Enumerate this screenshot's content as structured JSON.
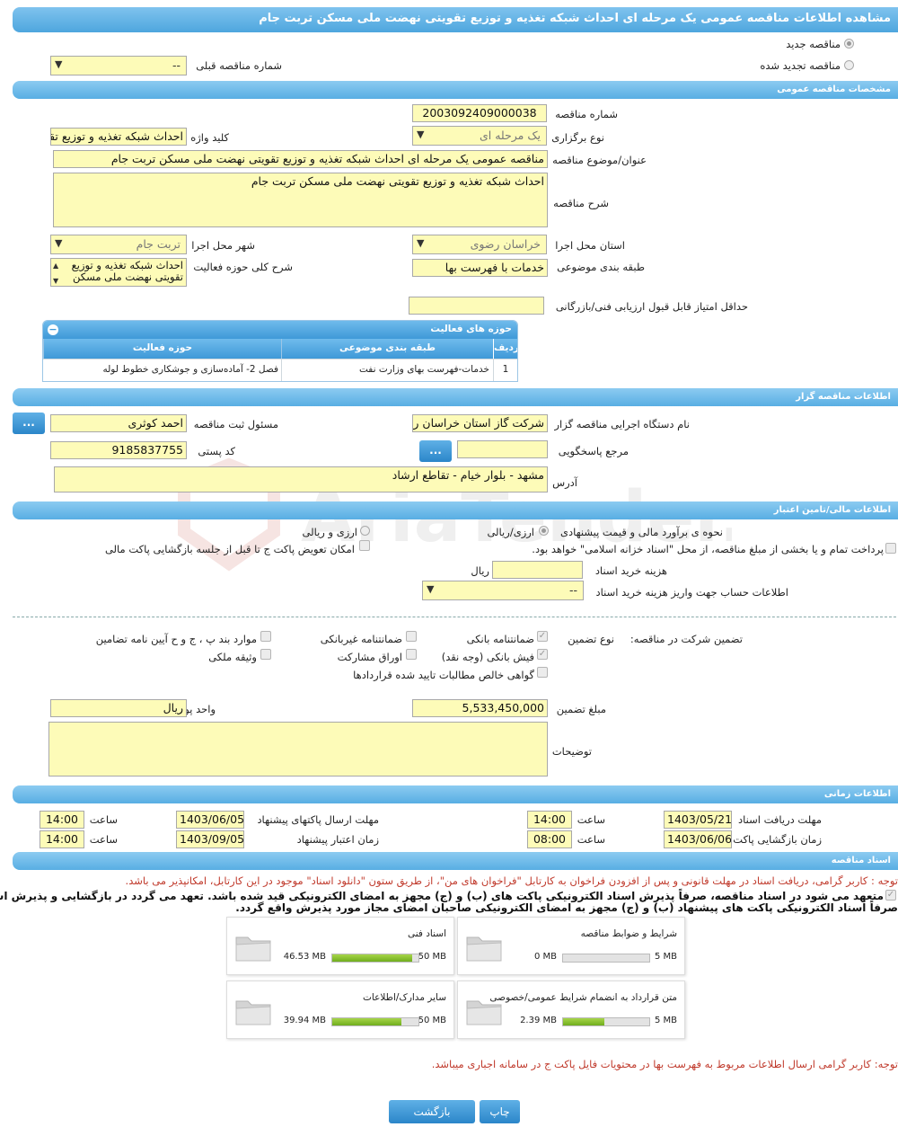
{
  "title": "مشاهده اطلاعات مناقصه عمومی یک مرحله ای احداث شبکه تغذیه و توزیع تقویتی نهضت ملی مسکن تربت جام",
  "header": {
    "new_tender": "مناقصه جدید",
    "renewed_tender": "مناقصه تجدید شده",
    "prev_tender_label": "شماره مناقصه قبلی",
    "prev_tender_value": "--"
  },
  "general": {
    "section_title": "مشخصات مناقصه عمومی",
    "tender_no_label": "شماره مناقصه",
    "tender_no": "2003092409000038",
    "hold_type_label": "نوع برگزاری",
    "hold_type": "یک مرحله ای",
    "keyword_label": "کلید واژه",
    "keyword": "احداث شبکه تغذیه و توزیع تقویتی",
    "subject_label": "عنوان/موضوع مناقصه",
    "subject": "مناقصه عمومی یک مرحله ای احداث شبکه تغذیه و توزیع تقویتی نهضت ملی مسکن تربت جام",
    "desc_label": "شرح مناقصه",
    "desc": "احداث شبکه تغذیه و توزیع تقویتی نهضت ملی مسکن تربت جام",
    "province_label": "استان محل اجرا",
    "province": "خراسان رضوی",
    "city_label": "شهر محل اجرا",
    "city": "تربت جام",
    "category_label": "طبقه بندی موضوعی",
    "category": "خدمات با فهرست بها",
    "scope_label": "شرح کلی حوزه فعالیت",
    "scope_line1": "احداث شبکه تغذیه و توزیع",
    "scope_line2": "تقویتی نهضت ملی مسکن",
    "min_score_label": "حداقل امتیاز قابل قبول ارزیابی فنی/بازرگانی",
    "min_score": ""
  },
  "activity_grid": {
    "title": "حوزه های فعالیت",
    "col_row": "ردیف",
    "col_category": "طبقه بندی موضوعی",
    "col_field": "حوزه فعالیت",
    "rows": [
      {
        "no": "1",
        "category": "خدمات-فهرست بهای وزارت نفت",
        "field": "فصل 2- آماده‌سازی و جوشکاری خطوط لوله"
      }
    ]
  },
  "organizer": {
    "section_title": "اطلاعات مناقصه گزار",
    "org_label": "نام دستگاه اجرایی مناقصه گزار",
    "org": "شرکت گاز استان خراسان رضوی",
    "officer_label": "مسئول ثبت مناقصه",
    "officer": "احمد کوثری",
    "ref_label": "مرجع پاسخگویی",
    "ref": "",
    "postal_label": "کد پستی",
    "postal": "9185837755",
    "address_label": "آدرس",
    "address": "مشهد - بلوار خیام - تقاطع ارشاد",
    "dots": "..."
  },
  "finance": {
    "section_title": "اطلاعات مالی/تامین اعتبار",
    "estimate_label": "نحوه ی برآورد مالی و قیمت پیشنهادی",
    "rial_option": "ارزی/ریالی",
    "fx_option": "ارزی و ریالی",
    "payment_text": "پرداخت تمام و یا بخشی از مبلغ مناقصه، از محل \"اسناد خزانه اسلامی\" خواهد بود.",
    "swap_text": "امکان تعویض پاکت ج تا قبل از جلسه بازگشایی پاکت مالی",
    "doc_fee_label": "هزینه خرید اسناد",
    "doc_fee": "",
    "currency_rial": "ریال",
    "account_label": "اطلاعات حساب جهت واریز هزینه خرید اسناد",
    "account_value": "--"
  },
  "guarantee": {
    "participation_label": "تضمین شرکت در مناقصه:",
    "type_label": "نوع تضمین",
    "bank_guarantee": "ضمانتنامه بانکی",
    "nonbank_guarantee": "ضمانتنامه غیربانکی",
    "items_bpj": "موارد بند پ ، ج و ح آیین نامه تضامین",
    "bank_receipt": "فیش بانکی (وجه نقد)",
    "partnership_bonds": "اوراق مشارکت",
    "property_bond": "وثیقه ملکی",
    "receivables_cert": "گواهی خالص مطالبات تایید شده قراردادها",
    "amount_label": "مبلغ تضمین",
    "amount": "5,533,450,000",
    "currency_label": "واحد پول",
    "currency": "ریال",
    "notes_label": "توضیحات",
    "notes": ""
  },
  "timing": {
    "section_title": "اطلاعات زمانی",
    "receive_deadline_label": "مهلت دریافت اسناد",
    "receive_deadline": "1403/05/21",
    "receive_time": "14:00",
    "send_deadline_label": "مهلت ارسال پاکتهای پیشنهاد",
    "send_deadline": "1403/06/05",
    "send_time": "14:00",
    "open_label": "زمان بازگشایی پاکت ها",
    "open_date": "1403/06/06",
    "open_time": "08:00",
    "validity_label": "زمان اعتبار پیشنهاد",
    "validity_date": "1403/09/05",
    "validity_time": "14:00",
    "time_label": "ساعت"
  },
  "documents": {
    "section_title": "اسناد مناقصه",
    "note1": "توجه : کاربر گرامی، دریافت اسناد در مهلت قانونی و پس از افزودن فراخوان به کارتابل \"فراخوان های من\"، از طریق ستون \"دانلود اسناد\" موجود در این کارتابل، امکانپذیر می باشد.",
    "commit_line1": "متعهد می شود در اسناد مناقصه، صرفاً پذیرش اسناد الکترونیکی پاکت های (ب) و (ج) مجهز به امضای الکترونیکی قید شده باشد. تعهد می گردد در بازگشایی و پذیرش اسناد،",
    "commit_line2": "صرفاً اسناد الکترونیکی پاکت های پیشنهاد (ب) و (ج) مجهز به امضای الکترونیکی صاحبان امضای مجاز مورد پذیرش واقع گردد.",
    "files": [
      {
        "name": "شرایط و ضوابط مناقصه",
        "used": "0 MB",
        "max": "5 MB",
        "ratio": 0
      },
      {
        "name": "اسناد فنی",
        "used": "46.53 MB",
        "max": "50 MB",
        "ratio": 0.93
      },
      {
        "name": "متن قرارداد به انضمام شرایط عمومی/خصوصی",
        "used": "2.39 MB",
        "max": "5 MB",
        "ratio": 0.48
      },
      {
        "name": "سایر مدارک/اطلاعات",
        "used": "39.94 MB",
        "max": "50 MB",
        "ratio": 0.8
      }
    ],
    "note2": "توجه: کاربر گرامی ارسال اطلاعات مربوط به فهرست بها در محتویات فایل پاکت ج در سامانه اجباری میباشد."
  },
  "buttons": {
    "print": "چاپ",
    "back": "بازگشت"
  },
  "watermark": "AriaTender.neT",
  "colors": {
    "bar": "#58aee3",
    "field_bg": "#fdfbb8",
    "note_red": "#c0392b",
    "progress": "#7dbb27"
  }
}
